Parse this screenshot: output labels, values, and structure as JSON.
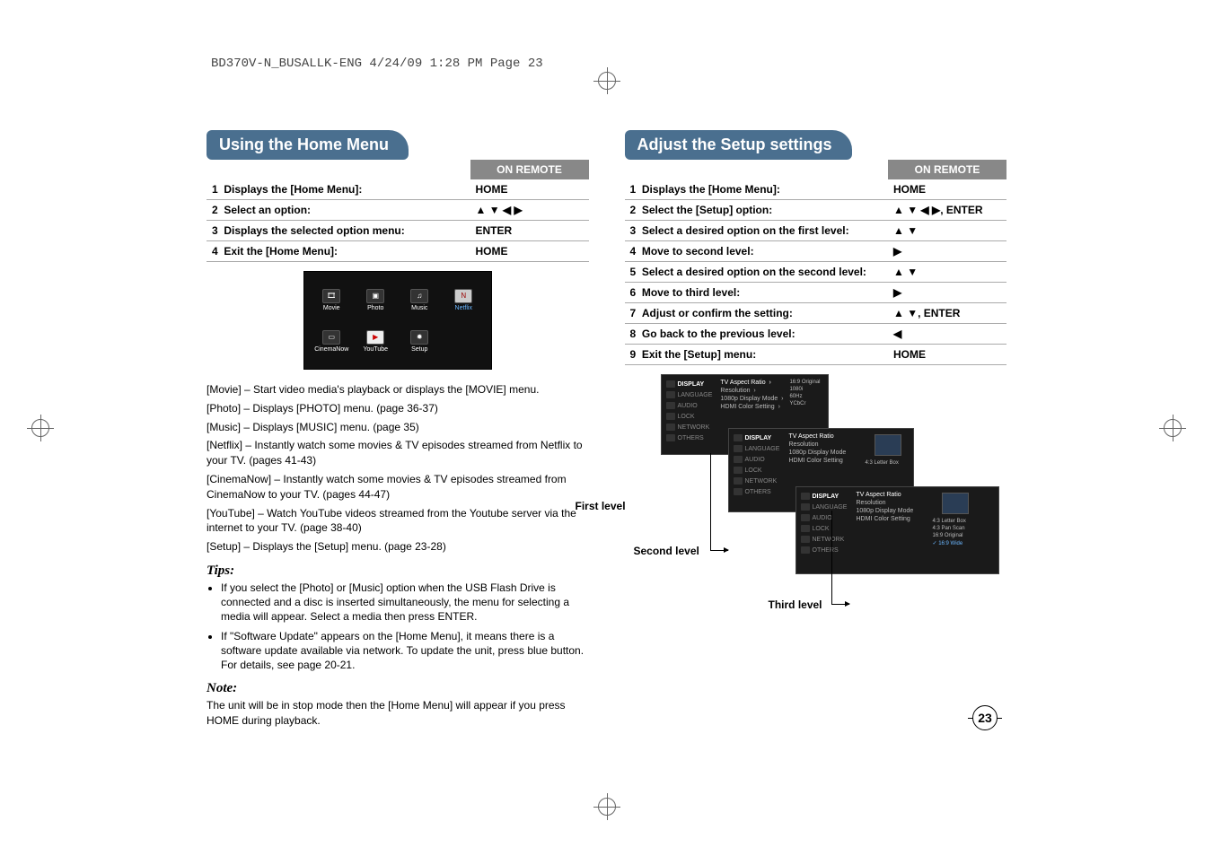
{
  "crop_info": "BD370V-N_BUSALLK-ENG  4/24/09  1:28 PM  Page 23",
  "page_number": "23",
  "left": {
    "title": "Using the Home Menu",
    "remote_header": "ON REMOTE",
    "steps": [
      {
        "n": "1",
        "label": "Displays the [Home Menu]:",
        "remote": "HOME"
      },
      {
        "n": "2",
        "label": "Select an option:",
        "remote": "▲ ▼ ◀ ▶"
      },
      {
        "n": "3",
        "label": "Displays the selected option menu:",
        "remote": "ENTER"
      },
      {
        "n": "4",
        "label": "Exit the [Home Menu]:",
        "remote": "HOME"
      }
    ],
    "home_items_row1": [
      {
        "label": "Movie",
        "glyph": "🎞"
      },
      {
        "label": "Photo",
        "glyph": "▣"
      },
      {
        "label": "Music",
        "glyph": "♫"
      },
      {
        "label": "Netflix",
        "glyph": "N"
      }
    ],
    "home_items_row2": [
      {
        "label": "CinemaNow",
        "glyph": "▭"
      },
      {
        "label": "YouTube",
        "glyph": "▶"
      },
      {
        "label": "Setup",
        "glyph": "✹"
      }
    ],
    "desc": [
      "[Movie] – Start video media's playback or displays the [MOVIE] menu.",
      "[Photo] – Displays [PHOTO] menu. (page 36-37)",
      "[Music] – Displays [MUSIC] menu. (page 35)",
      "[Netflix] – Instantly watch some movies & TV episodes streamed from Netflix to your TV. (pages 41-43)",
      "[CinemaNow] – Instantly watch some movies & TV episodes streamed from CinemaNow to your TV. (pages 44-47)",
      "[YouTube] – Watch YouTube videos streamed from the Youtube server via the internet to your TV. (page 38-40)",
      "[Setup] – Displays the [Setup] menu. (page 23-28)"
    ],
    "tips_h": "Tips:",
    "tips": [
      "If you select the [Photo] or [Music] option when the USB Flash Drive is connected and a disc is inserted simultaneously, the menu for selecting a media will appear. Select a media then press ENTER.",
      "If \"Software Update\" appears on the [Home Menu], it means there is a software update available via network. To update the unit, press blue button. For details, see page 20-21."
    ],
    "note_h": "Note:",
    "note": "The unit will be in stop mode then the [Home Menu] will appear if you press HOME during playback."
  },
  "right": {
    "title": "Adjust the Setup settings",
    "remote_header": "ON REMOTE",
    "steps": [
      {
        "n": "1",
        "label": "Displays the [Home Menu]:",
        "remote": "HOME"
      },
      {
        "n": "2",
        "label": "Select the [Setup] option:",
        "remote": "▲ ▼ ◀ ▶, ENTER"
      },
      {
        "n": "3",
        "label": "Select a desired option on the first level:",
        "remote": "▲ ▼"
      },
      {
        "n": "4",
        "label": "Move to second level:",
        "remote": "▶"
      },
      {
        "n": "5",
        "label": "Select a desired option on the second level:",
        "remote": "▲ ▼"
      },
      {
        "n": "6",
        "label": "Move to third level:",
        "remote": "▶"
      },
      {
        "n": "7",
        "label": "Adjust or confirm the setting:",
        "remote": "▲ ▼, ENTER"
      },
      {
        "n": "8",
        "label": "Go back to the previous level:",
        "remote": "◀"
      },
      {
        "n": "9",
        "label": "Exit the [Setup] menu:",
        "remote": "HOME"
      }
    ],
    "side_items": [
      "DISPLAY",
      "LANGUAGE",
      "AUDIO",
      "LOCK",
      "NETWORK",
      "OTHERS"
    ],
    "mid_items": [
      "TV Aspect Ratio",
      "Resolution",
      "1080p Display Mode",
      "HDMI Color Setting"
    ],
    "p1_right": [
      "16:9 Original",
      "1080i",
      "60Hz",
      "YCbCr"
    ],
    "p2_right_single": "4:3 Letter Box",
    "p3_right": [
      "4:3 Letter Box",
      "4:3 Pan Scan",
      "16:9 Original",
      "✓ 16:9 Wide"
    ],
    "labels": {
      "first": "First level",
      "second": "Second level",
      "third": "Third level"
    }
  }
}
